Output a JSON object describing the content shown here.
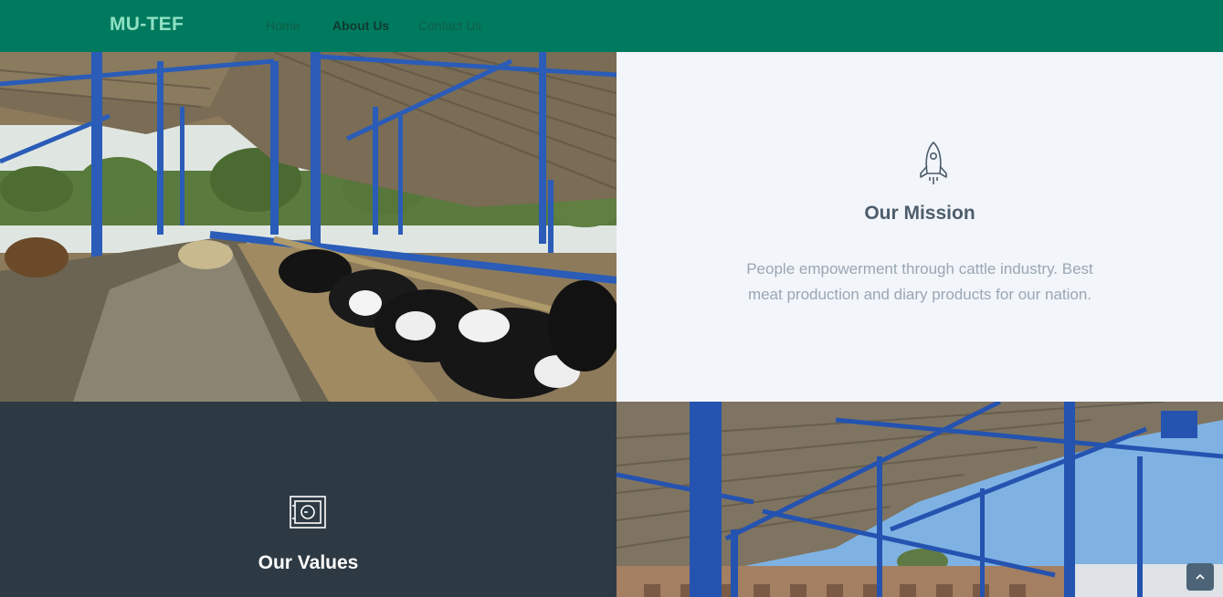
{
  "navbar": {
    "brand": "MU-TEF",
    "links": [
      {
        "label": "Home"
      },
      {
        "label": "About Us"
      },
      {
        "label": "Contact Us"
      }
    ],
    "color": "#007a5e"
  },
  "mission": {
    "icon": "rocket-icon",
    "title": "Our Mission",
    "text": "People empowerment through cattle industry. Best meat production and diary products for our nation."
  },
  "values": {
    "icon": "safe-icon",
    "title": "Our Values"
  },
  "back_to_top": {
    "icon": "chevron-up-icon"
  }
}
